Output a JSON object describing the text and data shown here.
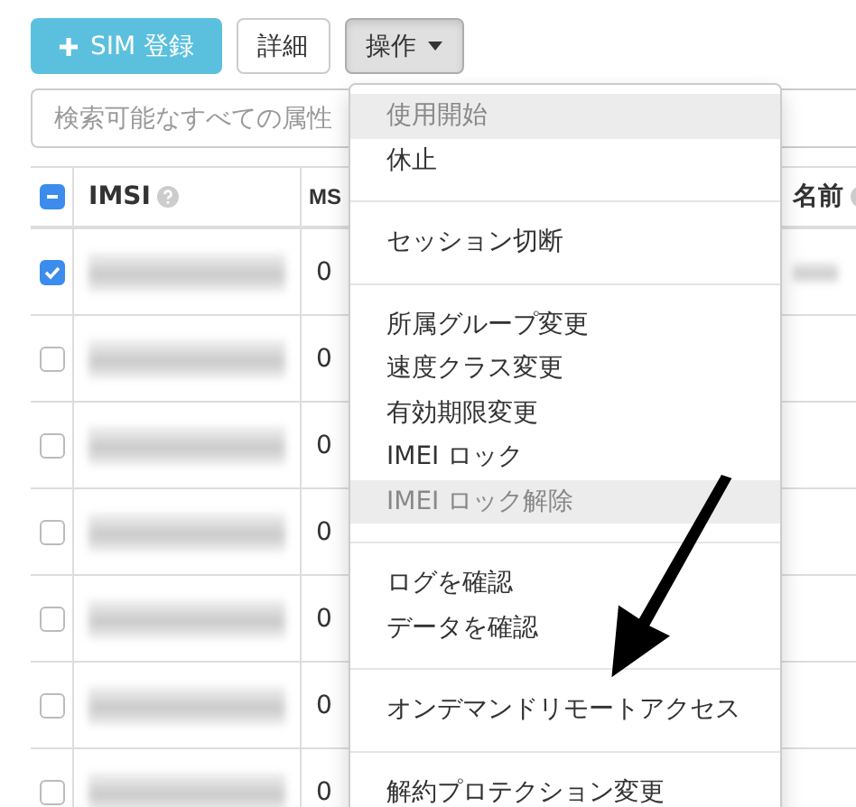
{
  "toolbar": {
    "buttons": [
      {
        "label": "SIM 登録",
        "kind": "primary"
      },
      {
        "label": "詳細",
        "kind": "default"
      },
      {
        "label": "操作",
        "kind": "dropdown",
        "expanded": true
      }
    ]
  },
  "search": {
    "placeholder": "検索可能なすべての属性"
  },
  "table": {
    "select_all": {
      "indeterminate": true
    },
    "columns": [
      {
        "label": "IMSI",
        "help": true
      },
      {
        "label": "MS",
        "help": false
      },
      {
        "label": "名前",
        "help": true
      }
    ],
    "rows": [
      {
        "checked": true,
        "column_2": "0",
        "name_redacted": true
      },
      {
        "checked": false,
        "column_2": "0",
        "name_redacted": false
      },
      {
        "checked": false,
        "column_2": "0",
        "name_redacted": false
      },
      {
        "checked": false,
        "column_2": "0",
        "name_redacted": false
      },
      {
        "checked": false,
        "column_2": "0",
        "name_redacted": false
      },
      {
        "checked": false,
        "column_2": "0",
        "name_redacted": false
      },
      {
        "checked": false,
        "column_2": "0",
        "name_redacted": false
      }
    ]
  },
  "menu": {
    "sections": [
      [
        {
          "label": "使用開始",
          "disabled": true
        },
        {
          "label": "休止",
          "disabled": false
        }
      ],
      [
        {
          "label": "セッション切断",
          "disabled": false
        }
      ],
      [
        {
          "label": "所属グループ変更",
          "disabled": false
        },
        {
          "label": "速度クラス変更",
          "disabled": false
        },
        {
          "label": "有効期限変更",
          "disabled": false
        },
        {
          "label": "IMEI ロック",
          "disabled": false
        },
        {
          "label": "IMEI ロック解除",
          "disabled": true
        }
      ],
      [
        {
          "label": "ログを確認",
          "disabled": false
        },
        {
          "label": "データを確認",
          "disabled": false
        }
      ],
      [
        {
          "label": "オンデマンドリモートアクセス",
          "disabled": false
        }
      ],
      [
        {
          "label": "解約プロテクション変更",
          "disabled": false
        }
      ]
    ]
  }
}
